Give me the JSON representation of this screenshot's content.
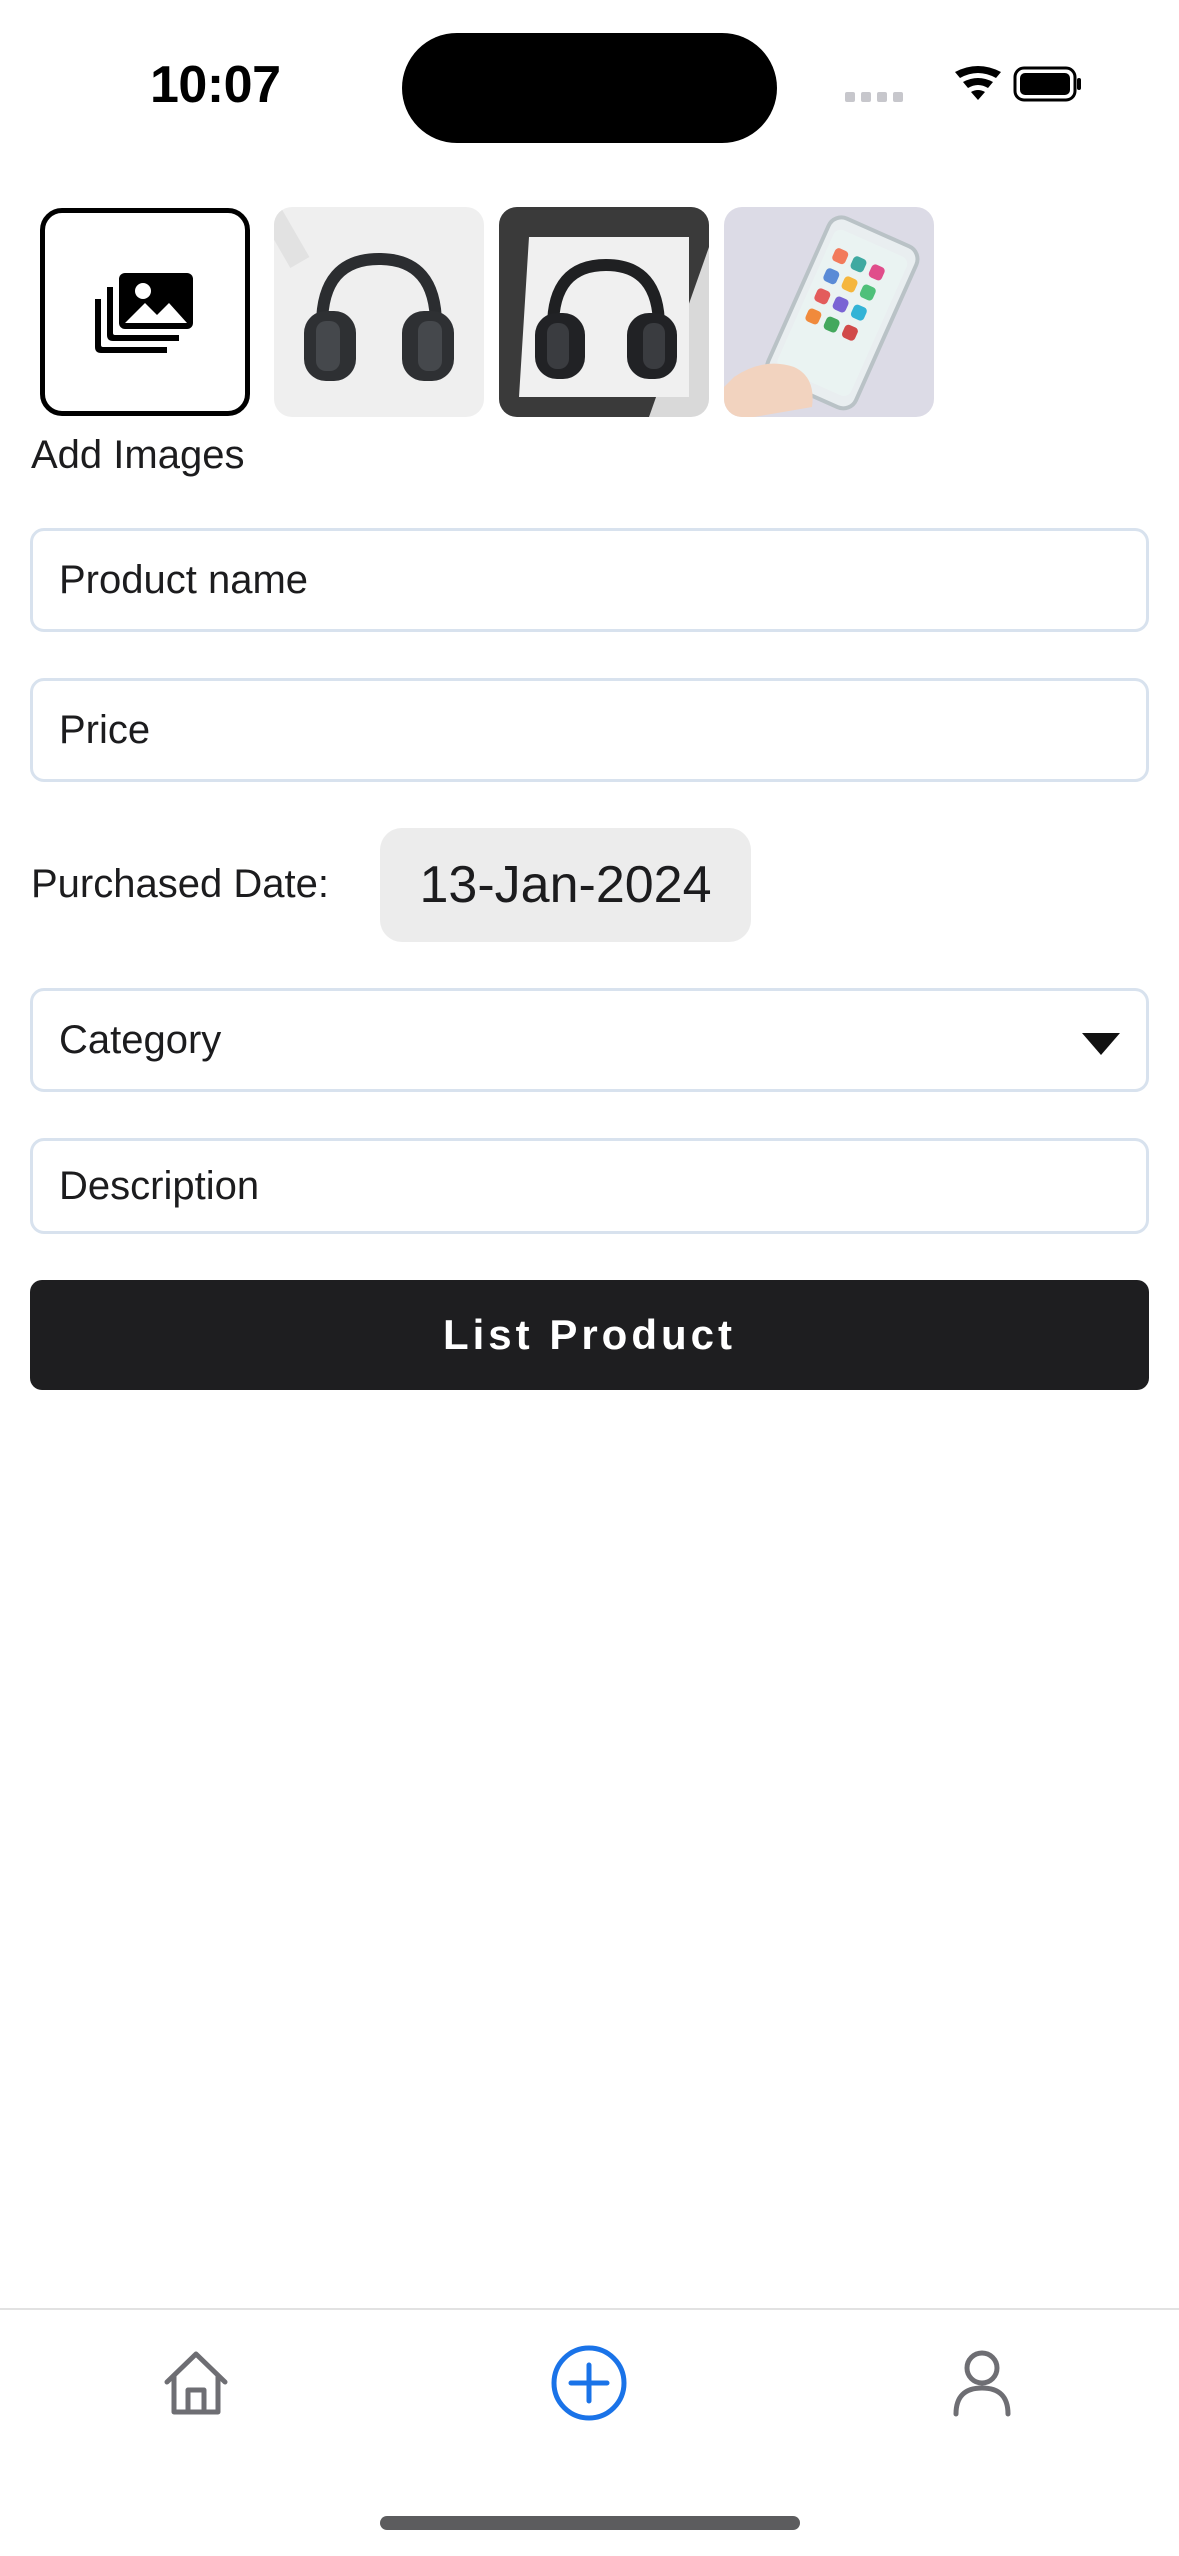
{
  "status_bar": {
    "time": "10:07"
  },
  "images": {
    "add_label": "Add Images",
    "thumbnails": [
      {
        "icon": "headphones-photo"
      },
      {
        "icon": "headphones-photo"
      },
      {
        "icon": "smartphone-photo"
      }
    ]
  },
  "form": {
    "product_name_placeholder": "Product name",
    "price_placeholder": "Price",
    "purchased_date_label": "Purchased Date:",
    "purchased_date_value": "13-Jan-2024",
    "category_placeholder": "Category",
    "description_placeholder": "Description",
    "submit_label": "List Product"
  },
  "tab_bar": {
    "items": [
      {
        "icon": "home-icon",
        "active": false
      },
      {
        "icon": "add-circle-icon",
        "active": true
      },
      {
        "icon": "profile-icon",
        "active": false
      }
    ],
    "active_color": "#1a73e8",
    "inactive_color": "#6e6e73"
  }
}
